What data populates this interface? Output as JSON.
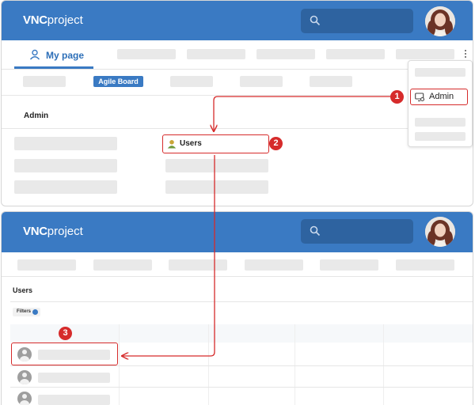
{
  "app": {
    "logo_vnc": "VNC",
    "logo_project": "project"
  },
  "top_screen": {
    "tab_my_page": "My page",
    "agile_board": "Agile Board",
    "admin_heading": "Admin",
    "menu_admin": "Admin",
    "users_link": "Users"
  },
  "bottom_screen": {
    "users_heading": "Users",
    "filters_label": "Filters"
  },
  "steps": [
    "1",
    "2",
    "3"
  ],
  "colors": {
    "brand_blue": "#3a7ac3",
    "callout_red": "#d62b2b",
    "placeholder_gray": "#e9e9e9"
  },
  "icons": [
    "search-icon",
    "user-icon",
    "kebab-menu-icon",
    "admin-icon",
    "users-icon",
    "user-avatar-icon"
  ]
}
